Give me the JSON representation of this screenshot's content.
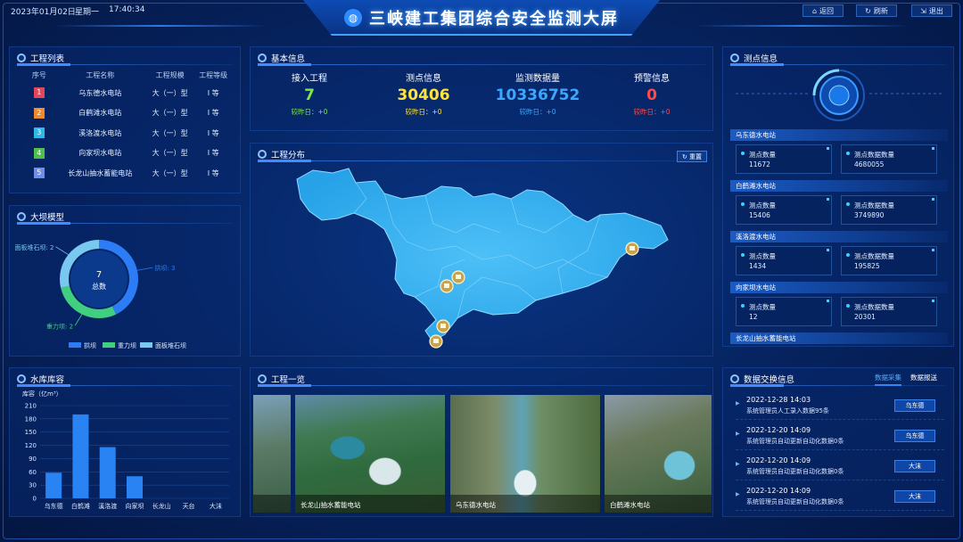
{
  "header": {
    "date": "2023年01月02日",
    "weekday": "星期一",
    "time": "17:40:34",
    "title": "三峡建工集团综合安全监测大屏",
    "buttons": {
      "back": "返回",
      "refresh": "刷新",
      "exit": "退出"
    }
  },
  "project_list": {
    "title": "工程列表",
    "columns": [
      "序号",
      "工程名称",
      "工程规模",
      "工程等级"
    ],
    "rows": [
      {
        "no": "1",
        "name": "乌东德水电站",
        "scale": "大（一）型",
        "grade": "I 等",
        "color": "#e0475a"
      },
      {
        "no": "2",
        "name": "白鹤滩水电站",
        "scale": "大（一）型",
        "grade": "I 等",
        "color": "#f08a2e"
      },
      {
        "no": "3",
        "name": "溪洛渡水电站",
        "scale": "大（一）型",
        "grade": "I 等",
        "color": "#2fb8e8"
      },
      {
        "no": "4",
        "name": "向家坝水电站",
        "scale": "大（一）型",
        "grade": "I 等",
        "color": "#4cc24a"
      },
      {
        "no": "5",
        "name": "长龙山抽水蓄能电站",
        "scale": "大（一）型",
        "grade": "I 等",
        "color": "#6f8ee8"
      }
    ]
  },
  "dam_model": {
    "title": "大坝模型",
    "total_value": "7",
    "total_label": "总数",
    "chart_data": {
      "type": "pie",
      "labels": [
        "拱坝",
        "重力坝",
        "面板堆石坝"
      ],
      "values": [
        3,
        2,
        2
      ],
      "colors": [
        "#2c7cf6",
        "#3fcf7e",
        "#79c8ef"
      ],
      "callouts": [
        "拱坝: 3",
        "重力坝: 2",
        "面板堆石坝: 2"
      ]
    }
  },
  "reservoir": {
    "title": "水库库容",
    "chart_data": {
      "type": "bar",
      "ylabel": "库容（亿m³）",
      "ylim": [
        0,
        210
      ],
      "yticks": [
        0,
        30,
        60,
        90,
        120,
        150,
        180,
        210
      ],
      "categories": [
        "乌东德",
        "白鹤滩",
        "溪洛渡",
        "向家坝",
        "长龙山",
        "天台",
        "大沫"
      ],
      "values": [
        58,
        190,
        116,
        50,
        0,
        0,
        0
      ],
      "color": "#2a83f2"
    }
  },
  "basic_info": {
    "title": "基本信息",
    "stats": [
      {
        "label": "接入工程",
        "value": "7",
        "compare": "较昨日：+0",
        "color": "#7ee54a",
        "cmp_color": "#7ee54a"
      },
      {
        "label": "测点信息",
        "value": "30406",
        "compare": "较昨日：+0",
        "color": "#ffe23a",
        "cmp_color": "#ffe23a"
      },
      {
        "label": "监测数据量",
        "value": "10336752",
        "compare": "较昨日：+0",
        "color": "#3fa6ff",
        "cmp_color": "#3fa6ff"
      },
      {
        "label": "预警信息",
        "value": "0",
        "compare": "较昨日：+0",
        "color": "#ff4a4a",
        "cmp_color": "#ff4a4a"
      }
    ]
  },
  "distribution": {
    "title": "工程分布",
    "reset": "重置"
  },
  "overview": {
    "title": "工程一览",
    "photos": [
      {
        "caption": ""
      },
      {
        "caption": "长龙山抽水蓄能电站"
      },
      {
        "caption": "乌东德水电站"
      },
      {
        "caption": "白鹤滩水电站"
      }
    ]
  },
  "measure_info": {
    "title": "测点信息",
    "sites": [
      {
        "name": "乌东德水电站",
        "points_label": "测点数量",
        "points": "11672",
        "data_label": "测点数据数量",
        "data": "4680055"
      },
      {
        "name": "白鹤滩水电站",
        "points_label": "测点数量",
        "points": "15406",
        "data_label": "测点数据数量",
        "data": "3749890"
      },
      {
        "name": "溪洛渡水电站",
        "points_label": "测点数量",
        "points": "1434",
        "data_label": "测点数据数量",
        "data": "195825"
      },
      {
        "name": "向家坝水电站",
        "points_label": "测点数量",
        "points": "12",
        "data_label": "测点数据数量",
        "data": "20301"
      },
      {
        "name": "长龙山抽水蓄能电站"
      }
    ]
  },
  "data_exchange": {
    "title": "数据交换信息",
    "tabs": [
      "数据采集",
      "数据报送"
    ],
    "rows": [
      {
        "time": "2022-12-28 14:03",
        "desc": "系统管理员人工录入数据95条",
        "tag": "乌东德"
      },
      {
        "time": "2022-12-20 14:09",
        "desc": "系统管理员自动更新自动化数据0条",
        "tag": "乌东德"
      },
      {
        "time": "2022-12-20 14:09",
        "desc": "系统管理员自动更新自动化数据0条",
        "tag": "大沫"
      },
      {
        "time": "2022-12-20 14:09",
        "desc": "系统管理员自动更新自动化数据0条",
        "tag": "大沫"
      }
    ]
  }
}
